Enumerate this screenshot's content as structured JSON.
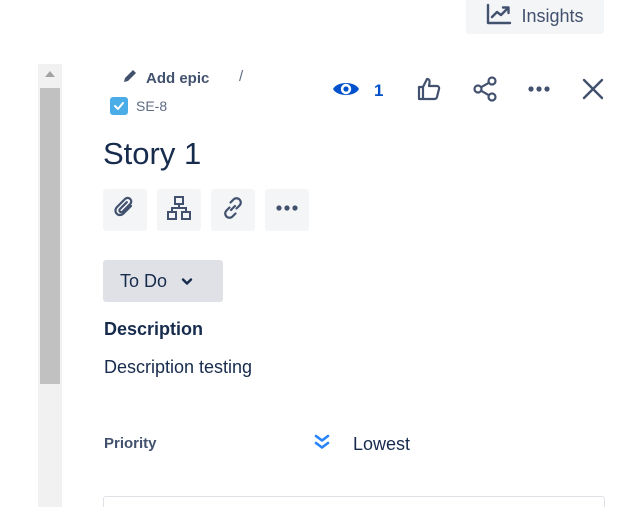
{
  "toolbar": {
    "insights_label": "Insights"
  },
  "breadcrumb": {
    "epic_label": "Add epic",
    "separator": "/",
    "issue_key": "SE-8"
  },
  "header": {
    "watchers_count": "1"
  },
  "issue": {
    "title": "Story 1",
    "status": "To Do",
    "description_heading": "Description",
    "description_text": "Description testing",
    "priority_label": "Priority",
    "priority_value": "Lowest"
  },
  "icons": {
    "insights": "chart-trend-icon",
    "edit": "pencil-icon",
    "issue_type": "story-checkbox-icon",
    "watch": "eye-icon",
    "like": "thumbs-up-icon",
    "share": "share-icon",
    "more": "more-icon",
    "close": "close-icon",
    "attach": "paperclip-icon",
    "child": "child-issues-icon",
    "link": "link-icon",
    "priority": "double-chevron-down-icon"
  },
  "colors": {
    "accent": "#0052cc",
    "story_blue": "#4bade8",
    "priority_lowest": "#2684ff"
  }
}
